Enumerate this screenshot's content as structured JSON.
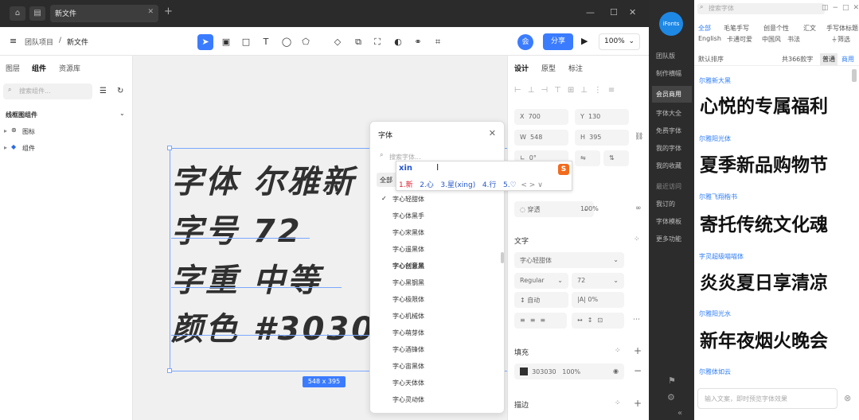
{
  "titlebar": {
    "tab": "新文件",
    "home_icon": "home-icon",
    "files_icon": "files-icon"
  },
  "toolbar": {
    "team": "团队项目",
    "sep": "/",
    "file": "新文件",
    "avatar": "会",
    "share": "分享",
    "zoom": "100%"
  },
  "left": {
    "tabs": [
      "图层",
      "组件",
      "资源库"
    ],
    "search_placeholder": "搜索组件...",
    "group": "线框图组件",
    "items": [
      "图标",
      "组件"
    ]
  },
  "canvas": {
    "lines": [
      "字体 尔雅新",
      "字号 72",
      "字重 中等",
      "颜色 #303030"
    ],
    "dim": "548 x 395",
    "help": "?"
  },
  "font_popup": {
    "title": "字体",
    "search_placeholder": "搜索字体...",
    "all": "全部",
    "check": "✓",
    "fonts": [
      "字心轻甜体",
      "字心体黑手",
      "字心宋黑体",
      "字心遥黑体",
      "字心创意黑",
      "字心黑钢黑",
      "字心极限体",
      "字心机械体",
      "字心萌芽体",
      "字心酒锋体",
      "字心宙黑体",
      "字心天体体",
      "字心灵动体"
    ]
  },
  "ime": {
    "pinyin": "xin",
    "candidates": [
      "1.新",
      "2.心",
      "3.星(xing)",
      "4.行",
      "5.♡"
    ],
    "logo": "S",
    "nav": "< > ∨"
  },
  "right": {
    "tabs": [
      "设计",
      "原型",
      "标注"
    ],
    "x_label": "X",
    "x_val": "700",
    "y_label": "Y",
    "y_val": "130",
    "w_label": "W",
    "w_val": "548",
    "h_label": "H",
    "h_val": "395",
    "r_label": "∟",
    "r_val": "0°",
    "layer_mode": "穿透",
    "opacity": "100%",
    "text_section": "文字",
    "font": "字心轻甜体",
    "weight": "Regular",
    "size": "72",
    "line_height": "自动",
    "letter_spacing": "0%",
    "fill_section": "填充",
    "fill_hex": "303030",
    "fill_opacity": "100%",
    "stroke_section": "描边"
  },
  "ifonts": {
    "logo": "iFonts",
    "nav": [
      "团队版",
      "制作横幅",
      "会员商用",
      "字体大全",
      "免费字体",
      "我的字体",
      "我的收藏",
      "最近访问",
      "我订的",
      "字体模板",
      "更多功能"
    ],
    "search_placeholder": "搜索字体",
    "cats_row1": [
      "全部",
      "毛笔手写",
      "创意个性",
      "汇文",
      "手写体标题"
    ],
    "cats_row2": [
      "English",
      "卡通可爱",
      "中国风",
      "书法"
    ],
    "filter": "筛选",
    "sort": "默认排序",
    "count": "共366款字",
    "mode_a": "普通",
    "mode_b": "商用",
    "fonts": [
      {
        "name": "尔雅新大黑",
        "sample": "心悦的专属福利"
      },
      {
        "name": "尔雅阳光体",
        "sample": "夏季新品购物节"
      },
      {
        "name": "尔雅飞翔楷书",
        "sample": "寄托传统文化魂"
      },
      {
        "name": "字灵超级喵喵体",
        "sample": "炎炎夏日享清凉"
      },
      {
        "name": "尔雅阳光水",
        "sample": "新年夜烟火晚会"
      },
      {
        "name": "尔雅体如云",
        "sample": ""
      }
    ],
    "input_placeholder": "输入文案，即时预览字体效果"
  }
}
